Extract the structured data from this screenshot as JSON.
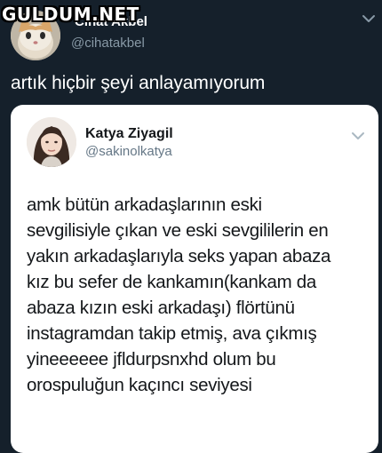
{
  "watermark": {
    "text": "GULDUM.NET"
  },
  "outer_tweet": {
    "author_name": "Cihat Akbel",
    "author_handle": "@cihatakbel",
    "avatar_icon": "kitten-avatar-icon",
    "text": "artık hiçbir şeyi anlayamıyorum"
  },
  "quoted_tweet": {
    "author_name": "Katya Ziyagil",
    "author_handle": "@sakinolkatya",
    "avatar_icon": "profile-photo-avatar",
    "lines": [
      "amk bütün arkadaşlarının eski",
      "sevgilisiyle çıkan ve eski sevgililerin en",
      "yakın arkadaşlarıyla seks yapan abaza",
      "kız bu sefer de kankamın(kankam da",
      "abaza kızın eski arkadaşı) flörtünü",
      "instagramdan takip etmiş, ava çıkmış",
      "yineeeeee jfldurpsnxhd olum bu",
      "orospuluğun kaçıncı seviyesi"
    ]
  },
  "colors": {
    "background": "#15202b",
    "card": "#ffffff",
    "secondary_text": "#8899a6"
  }
}
